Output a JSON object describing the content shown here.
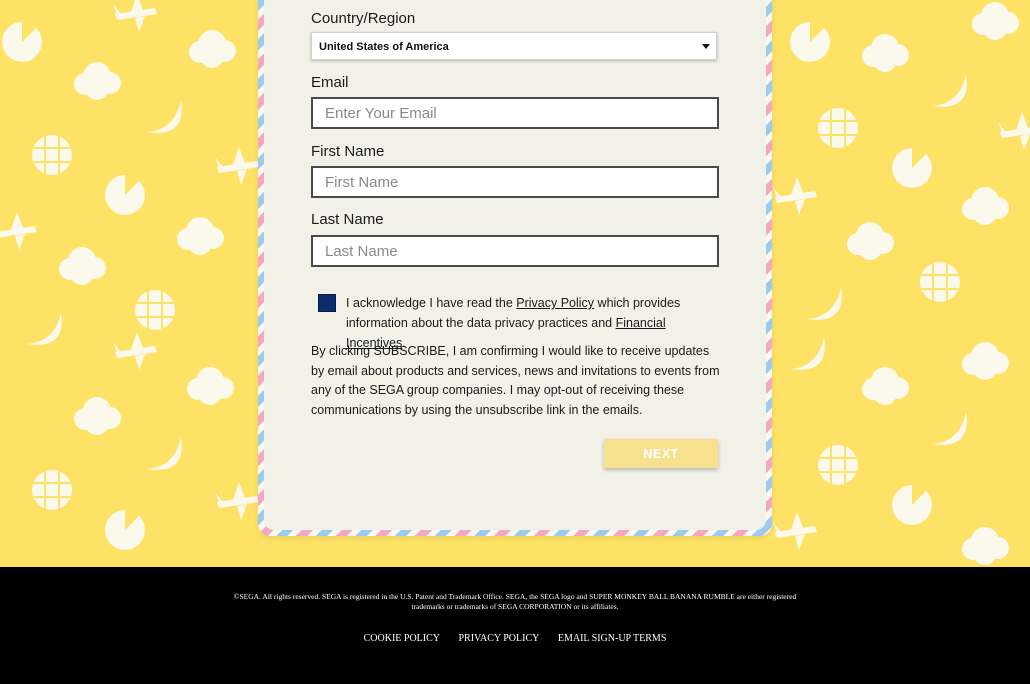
{
  "form": {
    "country_label": "Country/Region",
    "country_value": "United States of America",
    "email_label": "Email",
    "email_placeholder": "Enter Your Email",
    "first_name_label": "First Name",
    "first_name_placeholder": "First Name",
    "last_name_label": "Last Name",
    "last_name_placeholder": "Last Name",
    "ack_prefix": "I acknowledge I have read the ",
    "privacy_policy_link": "Privacy Policy",
    "ack_middle": " which provides information about the data privacy practices and ",
    "financial_incentives_link": "Financial Incentives",
    "ack_suffix": ".",
    "consent_text": "By clicking SUBSCRIBE, I am confirming I would like to receive updates by email about products and services, news and invitations to events from any of the SEGA group companies. I may opt-out of receiving these communications by using the unsubscribe link in the emails.",
    "next_label": "NEXT"
  },
  "footer": {
    "legal_line1": "©SEGA. All rights reserved. SEGA is registered in the U.S. Patent and Trademark Office. SEGA, the SEGA logo and SUPER MONKEY BALL BANANA RUMBLE are either registered",
    "legal_line2": "trademarks or trademarks of SEGA CORPORATION or its affiliates.",
    "links": [
      "COOKIE POLICY",
      "PRIVACY POLICY",
      "EMAIL SIGN-UP TERMS"
    ]
  },
  "colors": {
    "background": "#fde265",
    "card": "#f2f1e8",
    "checkbox": "#0c2c6e",
    "next_button": "#f7e18f",
    "footer": "#000000"
  }
}
